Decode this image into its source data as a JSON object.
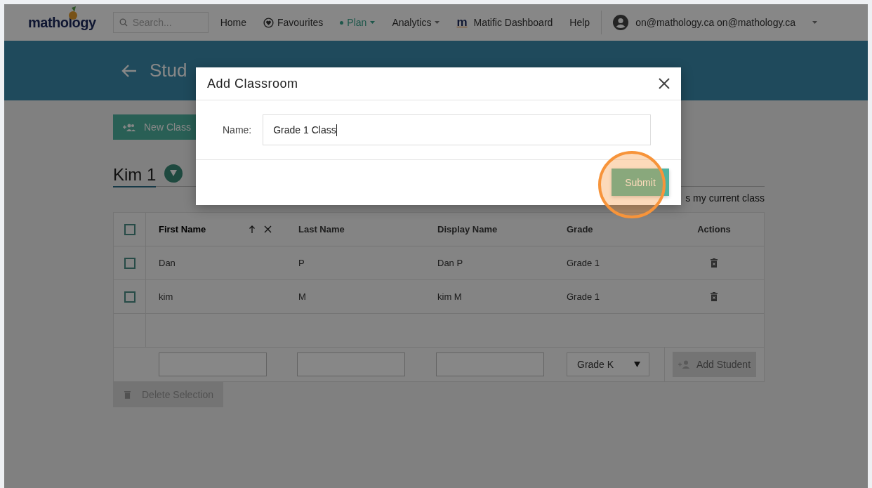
{
  "navbar": {
    "logo": "mathology",
    "search": {
      "placeholder": "Search..."
    },
    "items": [
      {
        "label": "Home",
        "kind": "link",
        "selected": false
      },
      {
        "label": "Favourites",
        "kind": "favourites",
        "selected": false
      },
      {
        "label": "Plan",
        "kind": "menu",
        "selected": true
      },
      {
        "label": "Analytics",
        "kind": "menu",
        "selected": false
      },
      {
        "label": "Matific Dashboard",
        "kind": "matific",
        "badge": "m",
        "selected": false
      },
      {
        "label": "Help",
        "kind": "link",
        "selected": false
      }
    ],
    "user": "on@mathology.ca on@mathology.ca"
  },
  "banner": {
    "title": "Stud"
  },
  "new_class_button": "New Class",
  "classroom": {
    "name": "Kim 1",
    "current_class_label": "s my current class"
  },
  "table": {
    "all_selected": false,
    "columns": [
      {
        "label": "First Name",
        "sorted": true
      },
      {
        "label": "Last Name",
        "sorted": false
      },
      {
        "label": "Display Name",
        "sorted": false
      },
      {
        "label": "Grade",
        "sorted": false
      },
      {
        "label": "Actions",
        "sorted": false
      }
    ],
    "rows": [
      {
        "selected": false,
        "cells": [
          "Dan",
          "P",
          "Dan P",
          "Grade 1"
        ]
      },
      {
        "selected": false,
        "cells": [
          "kim",
          "M",
          "kim M",
          "Grade 1"
        ]
      }
    ]
  },
  "new_student": {
    "grade": "Grade K",
    "add_button": "Add Student"
  },
  "delete_button": "Delete Selection",
  "dialog": {
    "title": "Add Classroom",
    "field_label": "Name:",
    "value": "Grade 1 Class",
    "submit": "Submit",
    "submit_highlighted": true
  }
}
